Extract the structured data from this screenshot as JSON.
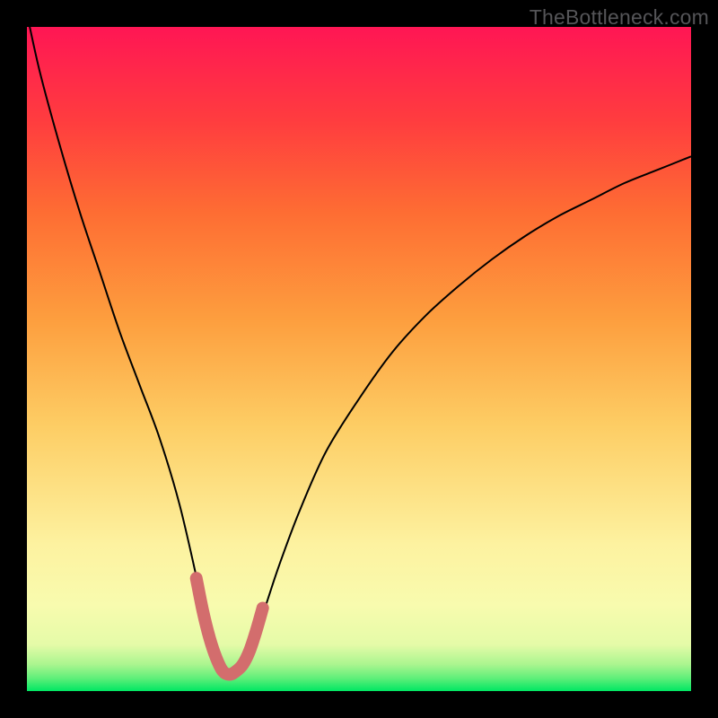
{
  "watermark": "TheBottleneck.com",
  "chart_data": {
    "type": "line",
    "title": "",
    "xlabel": "",
    "ylabel": "",
    "xlim": [
      0,
      100
    ],
    "ylim": [
      0,
      100
    ],
    "series": [
      {
        "name": "bottleneck-curve",
        "x": [
          0,
          2,
          5,
          8,
          11,
          14,
          17,
          20,
          23,
          26,
          27,
          28,
          29,
          30,
          31,
          32,
          33,
          34,
          36,
          38,
          41,
          45,
          50,
          55,
          60,
          65,
          70,
          75,
          80,
          85,
          90,
          95,
          100
        ],
        "values": [
          102,
          93,
          82,
          72,
          63,
          54,
          46,
          38,
          28,
          15,
          10,
          6,
          3.5,
          2.5,
          2.5,
          3,
          4.5,
          7,
          13,
          19,
          27,
          36,
          44,
          51,
          56.5,
          61,
          65,
          68.5,
          71.5,
          74,
          76.5,
          78.5,
          80.5
        ]
      },
      {
        "name": "highlight-segment",
        "x": [
          25.5,
          26.5,
          27.5,
          28.5,
          29.5,
          30.5,
          31.5,
          32.5,
          33.5,
          34.5,
          35.5
        ],
        "values": [
          17,
          12,
          8,
          5,
          3,
          2.5,
          3,
          4,
          6,
          9,
          12.5
        ]
      }
    ],
    "gradient_stops": [
      {
        "offset": 0.0,
        "color": "#00e763"
      },
      {
        "offset": 0.02,
        "color": "#62ef7a"
      },
      {
        "offset": 0.04,
        "color": "#aaf58f"
      },
      {
        "offset": 0.07,
        "color": "#e5fba8"
      },
      {
        "offset": 0.13,
        "color": "#f8fbae"
      },
      {
        "offset": 0.22,
        "color": "#fdf2a0"
      },
      {
        "offset": 0.4,
        "color": "#fdcd64"
      },
      {
        "offset": 0.56,
        "color": "#fd9e3e"
      },
      {
        "offset": 0.72,
        "color": "#fe6d33"
      },
      {
        "offset": 0.86,
        "color": "#ff3c3f"
      },
      {
        "offset": 1.0,
        "color": "#ff1654"
      }
    ],
    "curve_color": "#000000",
    "highlight_color": "#d36d6d"
  }
}
